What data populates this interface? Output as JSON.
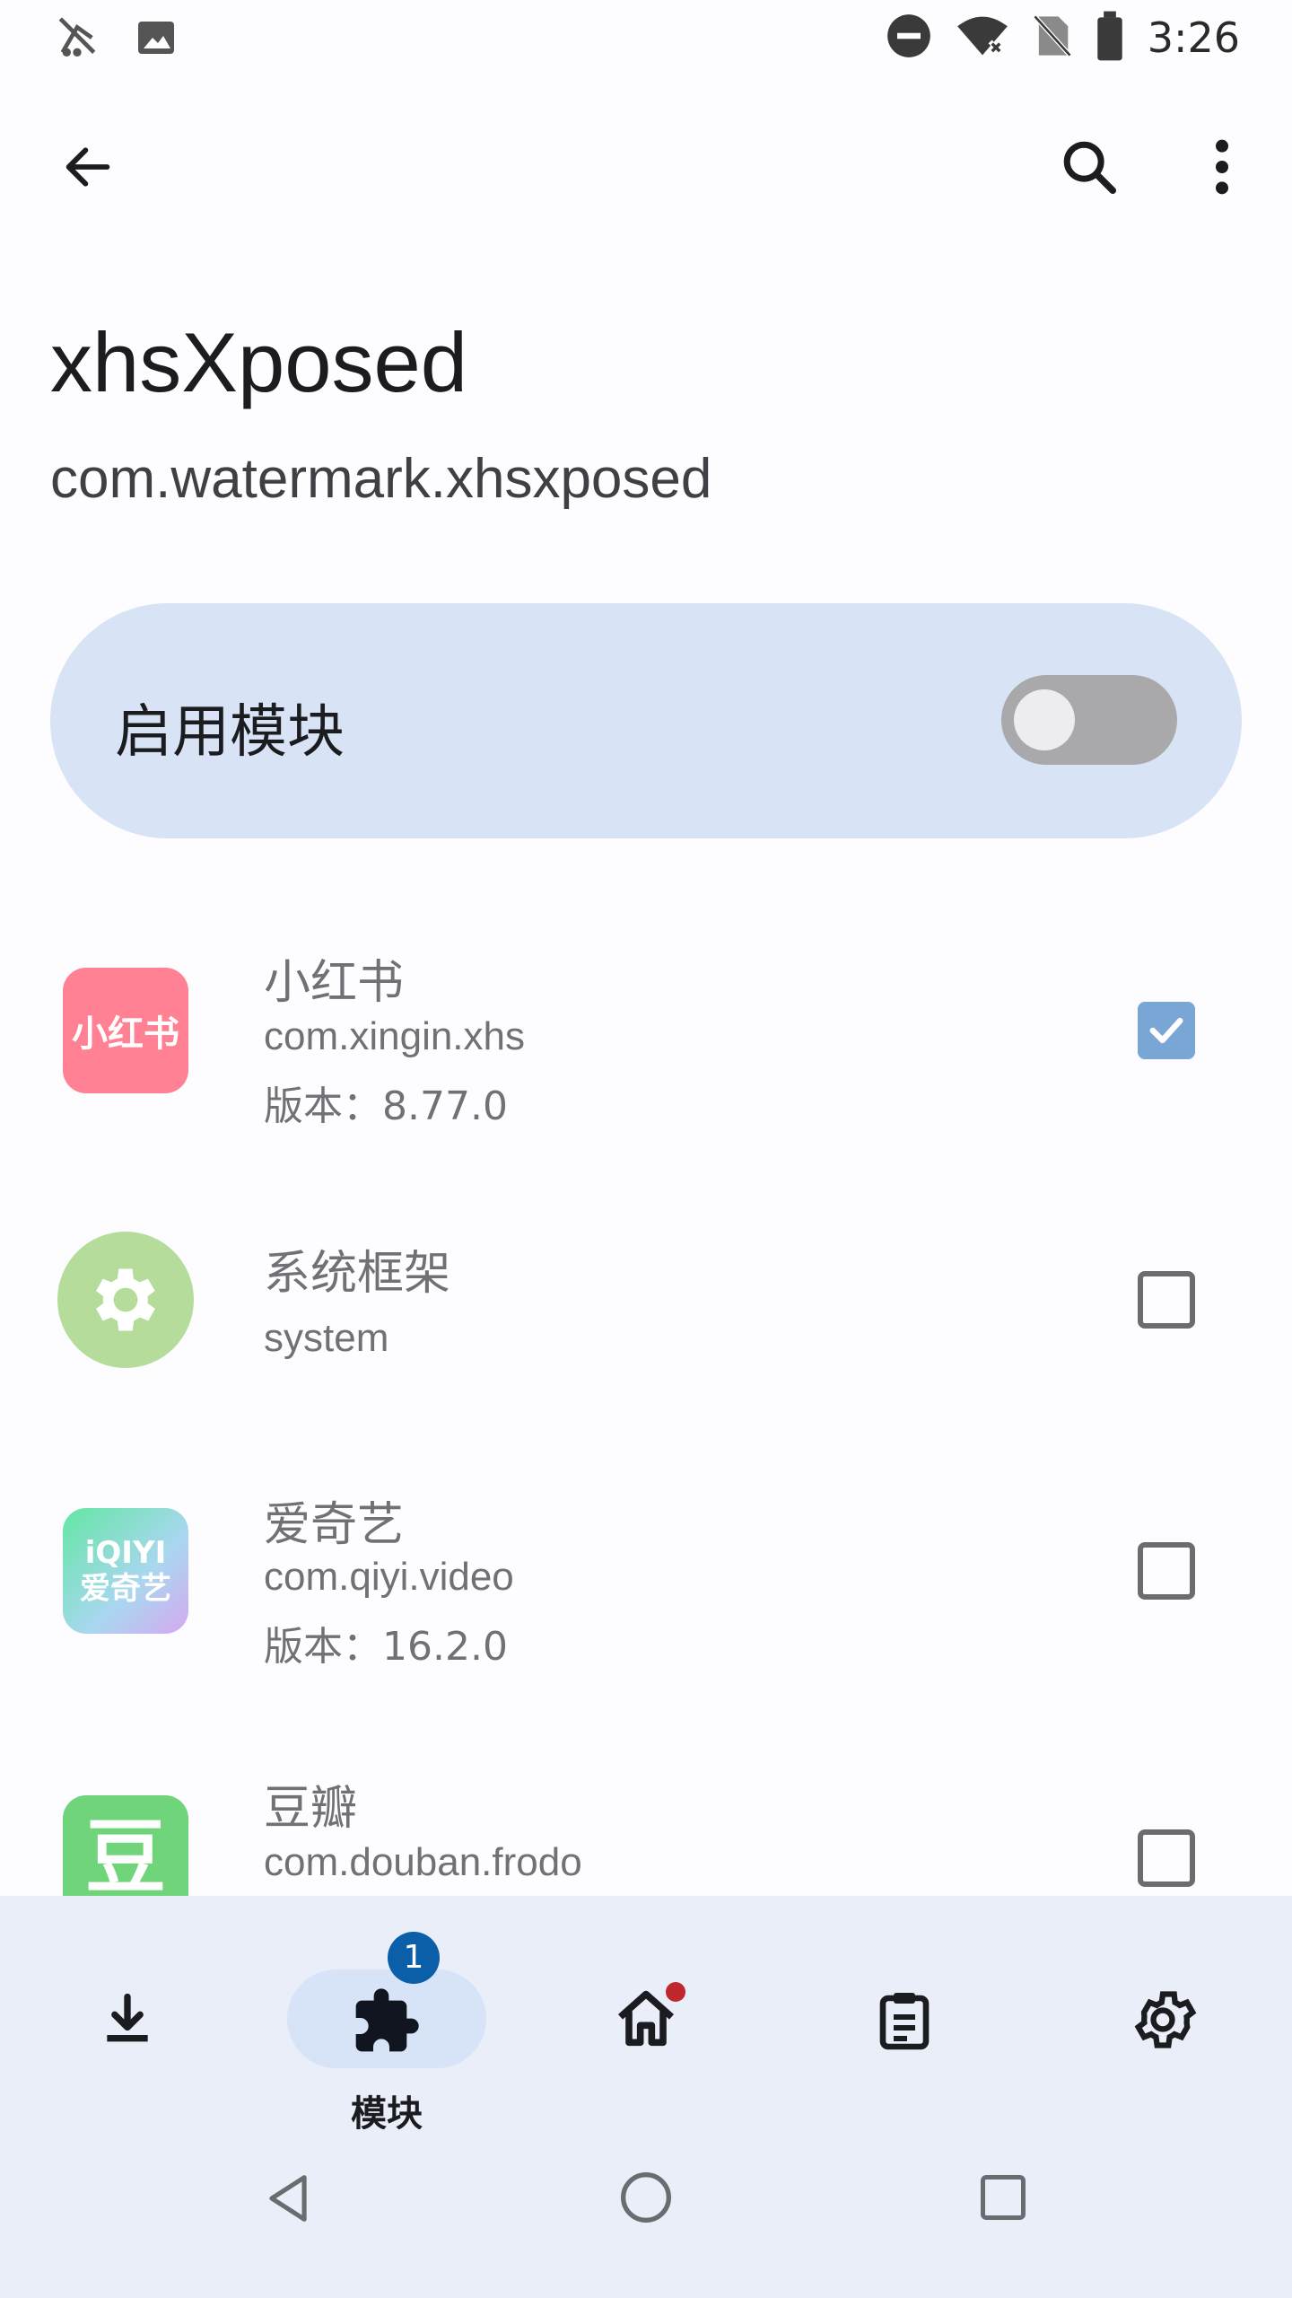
{
  "status_bar": {
    "time": "3:26",
    "left_icons": [
      "bug-icon",
      "image-icon"
    ],
    "right_icons": [
      "do-not-disturb-icon",
      "wifi-off-icon",
      "no-sim-icon",
      "battery-icon"
    ]
  },
  "app_bar": {
    "back_icon": "arrow-back-icon",
    "search_icon": "search-icon",
    "menu_icon": "more-vert-icon"
  },
  "header": {
    "title": "xhsXposed",
    "package": "com.watermark.xhsxposed"
  },
  "enable_card": {
    "label": "启用模块",
    "enabled": false
  },
  "apps": [
    {
      "name": "小红书",
      "package": "com.xingin.xhs",
      "version": "版本：8.77.0",
      "checked": true,
      "icon_text": "小红书",
      "icon_color": "#ff7a8a"
    },
    {
      "name": "系统框架",
      "package": "system",
      "version": "",
      "checked": false,
      "icon_text": "",
      "icon_color": "#a8d58c"
    },
    {
      "name": "爱奇艺",
      "package": "com.qiyi.video",
      "version": "版本：16.2.0",
      "checked": false,
      "icon_text": "iQIYI 爱奇艺",
      "icon_color": "#6ee7a0"
    },
    {
      "name": "豆瓣",
      "package": "com.douban.frodo",
      "version": "",
      "checked": false,
      "icon_text": "豆",
      "icon_color": "#6fd36f"
    }
  ],
  "bottom_nav": {
    "items": [
      {
        "id": "download",
        "icon": "download-icon",
        "label": ""
      },
      {
        "id": "modules",
        "icon": "puzzle-icon",
        "label": "模块",
        "badge": "1",
        "active": true
      },
      {
        "id": "home",
        "icon": "home-icon",
        "label": "",
        "dot": true
      },
      {
        "id": "logs",
        "icon": "clipboard-icon",
        "label": ""
      },
      {
        "id": "settings",
        "icon": "gear-icon",
        "label": ""
      }
    ]
  },
  "system_nav": [
    "back-triangle-icon",
    "home-circle-icon",
    "recents-square-icon"
  ],
  "colors": {
    "accent": "#0b5ea8",
    "card": "#d8e3f6",
    "nav_bg": "#e9eef8"
  }
}
